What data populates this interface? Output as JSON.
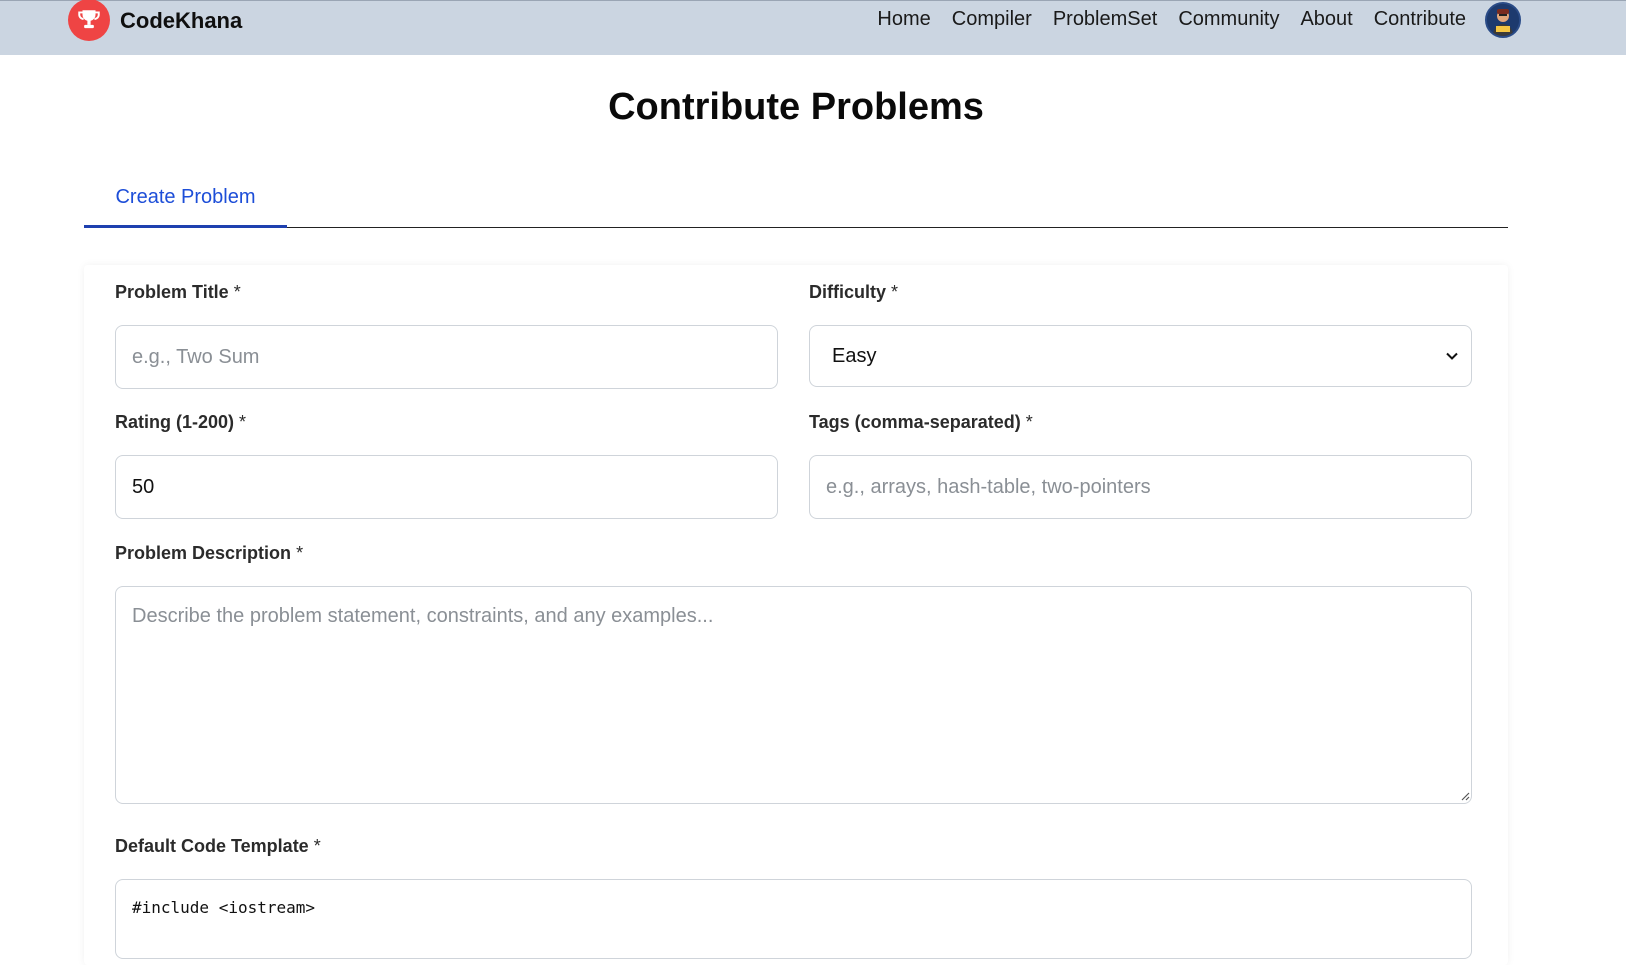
{
  "navbar": {
    "brand": "CodeKhana",
    "brand_icon": "trophy-icon",
    "brand_color": "#ef4444",
    "background": "#cbd5e1",
    "links": [
      {
        "label": "Home"
      },
      {
        "label": "Compiler"
      },
      {
        "label": "ProblemSet"
      },
      {
        "label": "Community"
      },
      {
        "label": "About"
      },
      {
        "label": "Contribute"
      }
    ],
    "avatar_icon": "user-avatar-icon"
  },
  "page": {
    "title": "Contribute Problems"
  },
  "tabs": [
    {
      "label": "Create Problem",
      "active": true
    }
  ],
  "form": {
    "title": {
      "label": "Problem Title",
      "required": "*",
      "placeholder": "e.g., Two Sum",
      "value": ""
    },
    "difficulty": {
      "label": "Difficulty",
      "required": "*",
      "selected": "Easy"
    },
    "rating": {
      "label": "Rating (1-200)",
      "required": "*",
      "value": "50"
    },
    "tags": {
      "label": "Tags (comma-separated)",
      "required": "*",
      "placeholder": "e.g., arrays, hash-table, two-pointers",
      "value": ""
    },
    "description": {
      "label": "Problem Description",
      "required": "*",
      "placeholder": "Describe the problem statement, constraints, and any examples..."
    },
    "code_template": {
      "label": "Default Code Template",
      "required": "*",
      "first_line": "#include <iostream>"
    }
  },
  "colors": {
    "accent": "#1d4ed8",
    "tab_underline": "#1e40af",
    "border": "#cfd4da"
  }
}
